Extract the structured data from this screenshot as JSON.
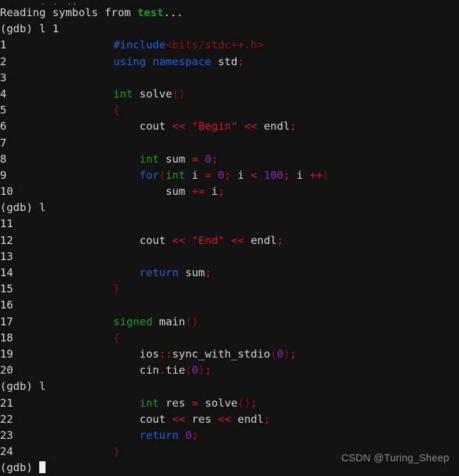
{
  "terminal": {
    "background_color": "#121212",
    "foreground_color": "#d4d4d4",
    "prompt": "(gdb)",
    "colors": {
      "keyword_blue": "#2060e0",
      "type_green": "#18a018",
      "bracket_darkred": "#8c1010",
      "operator_red": "#e01020",
      "string_red": "#e01020",
      "number_purple": "#9020c0",
      "identifier_white": "#d4d4d4",
      "linenumber_gray": "#d8d8d8"
    }
  },
  "lines": [
    {
      "kind": "clipped",
      "gutter": "",
      "tokens": [
        {
          "t": "ype = int ()",
          "c": "id"
        }
      ]
    },
    {
      "kind": "output",
      "gutter": "",
      "tokens": [
        {
          "t": "Reading symbols from ",
          "c": "id"
        },
        {
          "t": "test",
          "c": "grn"
        },
        {
          "t": "...",
          "c": "id"
        }
      ]
    },
    {
      "kind": "command",
      "gutter": "",
      "tokens": [
        {
          "t": "(gdb) l 1",
          "c": "prompt"
        }
      ]
    },
    {
      "kind": "code",
      "gutter": "1",
      "tokens": [
        {
          "t": "\t",
          "c": "id"
        },
        {
          "t": "#include",
          "c": "kw"
        },
        {
          "t": "<bits/stdc++.h>",
          "c": "brk"
        }
      ]
    },
    {
      "kind": "code",
      "gutter": "2",
      "tokens": [
        {
          "t": "\t",
          "c": "id"
        },
        {
          "t": "using namespace",
          "c": "kw"
        },
        {
          "t": " std",
          "c": "id"
        },
        {
          "t": ";",
          "c": "op"
        }
      ]
    },
    {
      "kind": "code",
      "gutter": "3",
      "tokens": []
    },
    {
      "kind": "code",
      "gutter": "4",
      "tokens": [
        {
          "t": "\t",
          "c": "id"
        },
        {
          "t": "int",
          "c": "typ"
        },
        {
          "t": " solve",
          "c": "id"
        },
        {
          "t": "()",
          "c": "brk"
        }
      ]
    },
    {
      "kind": "code",
      "gutter": "5",
      "tokens": [
        {
          "t": "\t",
          "c": "id"
        },
        {
          "t": "{",
          "c": "brk"
        }
      ]
    },
    {
      "kind": "code",
      "gutter": "6",
      "tokens": [
        {
          "t": "\t    ",
          "c": "id"
        },
        {
          "t": "cout ",
          "c": "id"
        },
        {
          "t": "<<",
          "c": "op"
        },
        {
          "t": " ",
          "c": "id"
        },
        {
          "t": "\"Begin\"",
          "c": "str"
        },
        {
          "t": " ",
          "c": "id"
        },
        {
          "t": "<<",
          "c": "op"
        },
        {
          "t": " endl",
          "c": "id"
        },
        {
          "t": ";",
          "c": "op"
        }
      ]
    },
    {
      "kind": "code",
      "gutter": "7",
      "tokens": []
    },
    {
      "kind": "code",
      "gutter": "8",
      "tokens": [
        {
          "t": "\t    ",
          "c": "id"
        },
        {
          "t": "int",
          "c": "typ"
        },
        {
          "t": " sum ",
          "c": "id"
        },
        {
          "t": "=",
          "c": "op"
        },
        {
          "t": " ",
          "c": "id"
        },
        {
          "t": "0",
          "c": "num"
        },
        {
          "t": ";",
          "c": "op"
        }
      ]
    },
    {
      "kind": "code",
      "gutter": "9",
      "tokens": [
        {
          "t": "\t    ",
          "c": "id"
        },
        {
          "t": "for",
          "c": "kw"
        },
        {
          "t": "(",
          "c": "brk"
        },
        {
          "t": "int",
          "c": "typ"
        },
        {
          "t": " i ",
          "c": "id"
        },
        {
          "t": "=",
          "c": "op"
        },
        {
          "t": " ",
          "c": "id"
        },
        {
          "t": "0",
          "c": "num"
        },
        {
          "t": ";",
          "c": "op"
        },
        {
          "t": " i ",
          "c": "id"
        },
        {
          "t": "<",
          "c": "op"
        },
        {
          "t": " ",
          "c": "id"
        },
        {
          "t": "100",
          "c": "num"
        },
        {
          "t": ";",
          "c": "op"
        },
        {
          "t": " i ",
          "c": "id"
        },
        {
          "t": "++",
          "c": "op"
        },
        {
          "t": ")",
          "c": "brk"
        }
      ]
    },
    {
      "kind": "code",
      "gutter": "10",
      "tokens": [
        {
          "t": "\t        ",
          "c": "id"
        },
        {
          "t": "sum ",
          "c": "id"
        },
        {
          "t": "+=",
          "c": "op"
        },
        {
          "t": " i",
          "c": "id"
        },
        {
          "t": ";",
          "c": "op"
        }
      ]
    },
    {
      "kind": "command",
      "gutter": "",
      "tokens": [
        {
          "t": "(gdb) l",
          "c": "prompt"
        }
      ]
    },
    {
      "kind": "code",
      "gutter": "11",
      "tokens": []
    },
    {
      "kind": "code",
      "gutter": "12",
      "tokens": [
        {
          "t": "\t    ",
          "c": "id"
        },
        {
          "t": "cout ",
          "c": "id"
        },
        {
          "t": "<<",
          "c": "op"
        },
        {
          "t": " ",
          "c": "id"
        },
        {
          "t": "\"End\"",
          "c": "str"
        },
        {
          "t": " ",
          "c": "id"
        },
        {
          "t": "<<",
          "c": "op"
        },
        {
          "t": " endl",
          "c": "id"
        },
        {
          "t": ";",
          "c": "op"
        }
      ]
    },
    {
      "kind": "code",
      "gutter": "13",
      "tokens": []
    },
    {
      "kind": "code",
      "gutter": "14",
      "tokens": [
        {
          "t": "\t    ",
          "c": "id"
        },
        {
          "t": "return",
          "c": "kw"
        },
        {
          "t": " sum",
          "c": "id"
        },
        {
          "t": ";",
          "c": "op"
        }
      ]
    },
    {
      "kind": "code",
      "gutter": "15",
      "tokens": [
        {
          "t": "\t",
          "c": "id"
        },
        {
          "t": "}",
          "c": "brk"
        }
      ]
    },
    {
      "kind": "code",
      "gutter": "16",
      "tokens": []
    },
    {
      "kind": "code",
      "gutter": "17",
      "tokens": [
        {
          "t": "\t",
          "c": "id"
        },
        {
          "t": "signed",
          "c": "typ"
        },
        {
          "t": " main",
          "c": "id"
        },
        {
          "t": "()",
          "c": "brk"
        }
      ]
    },
    {
      "kind": "code",
      "gutter": "18",
      "tokens": [
        {
          "t": "\t",
          "c": "id"
        },
        {
          "t": "{",
          "c": "brk"
        }
      ]
    },
    {
      "kind": "code",
      "gutter": "19",
      "tokens": [
        {
          "t": "\t    ",
          "c": "id"
        },
        {
          "t": "ios",
          "c": "id"
        },
        {
          "t": "::",
          "c": "op"
        },
        {
          "t": "sync_with_stdio",
          "c": "id"
        },
        {
          "t": "(",
          "c": "brk"
        },
        {
          "t": "0",
          "c": "num"
        },
        {
          "t": ")",
          "c": "brk"
        },
        {
          "t": ";",
          "c": "op"
        }
      ]
    },
    {
      "kind": "code",
      "gutter": "20",
      "tokens": [
        {
          "t": "\t    ",
          "c": "id"
        },
        {
          "t": "cin",
          "c": "id"
        },
        {
          "t": ".",
          "c": "op"
        },
        {
          "t": "tie",
          "c": "id"
        },
        {
          "t": "(",
          "c": "brk"
        },
        {
          "t": "0",
          "c": "num"
        },
        {
          "t": ")",
          "c": "brk"
        },
        {
          "t": ";",
          "c": "op"
        }
      ]
    },
    {
      "kind": "command",
      "gutter": "",
      "tokens": [
        {
          "t": "(gdb) l",
          "c": "prompt"
        }
      ]
    },
    {
      "kind": "code",
      "gutter": "21",
      "tokens": [
        {
          "t": "\t    ",
          "c": "id"
        },
        {
          "t": "int",
          "c": "typ"
        },
        {
          "t": " res ",
          "c": "id"
        },
        {
          "t": "=",
          "c": "op"
        },
        {
          "t": " solve",
          "c": "id"
        },
        {
          "t": "()",
          "c": "brk"
        },
        {
          "t": ";",
          "c": "op"
        }
      ]
    },
    {
      "kind": "code",
      "gutter": "22",
      "tokens": [
        {
          "t": "\t    ",
          "c": "id"
        },
        {
          "t": "cout ",
          "c": "id"
        },
        {
          "t": "<<",
          "c": "op"
        },
        {
          "t": " res ",
          "c": "id"
        },
        {
          "t": "<<",
          "c": "op"
        },
        {
          "t": " endl",
          "c": "id"
        },
        {
          "t": ";",
          "c": "op"
        }
      ]
    },
    {
      "kind": "code",
      "gutter": "23",
      "tokens": [
        {
          "t": "\t    ",
          "c": "id"
        },
        {
          "t": "return",
          "c": "kw"
        },
        {
          "t": " ",
          "c": "id"
        },
        {
          "t": "0",
          "c": "num"
        },
        {
          "t": ";",
          "c": "op"
        }
      ]
    },
    {
      "kind": "code",
      "gutter": "24",
      "tokens": [
        {
          "t": "\t",
          "c": "id"
        },
        {
          "t": "}",
          "c": "brk"
        }
      ]
    },
    {
      "kind": "prompt_cursor",
      "gutter": "",
      "tokens": [
        {
          "t": "(gdb) ",
          "c": "prompt"
        }
      ]
    }
  ],
  "watermark": {
    "text": "CSDN @Turing_Sheep"
  }
}
